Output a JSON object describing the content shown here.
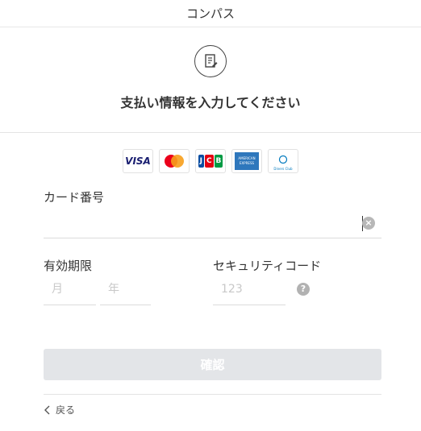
{
  "topbar": {
    "title": "コンパス"
  },
  "header": {
    "title": "支払い情報を入力してください"
  },
  "cards": [
    {
      "name": "VISA",
      "text": "VISA",
      "color": "#1a1f71"
    },
    {
      "name": "Mastercard",
      "text": "",
      "color": "#eb001b"
    },
    {
      "name": "JCB",
      "text": "JCB",
      "color": "#0b4ea2"
    },
    {
      "name": "American Express",
      "text": "AMERICAN EXPRESS",
      "color": "#2e77bc"
    },
    {
      "name": "Diners Club",
      "text": "Diners Club",
      "color": "#0079be"
    }
  ],
  "form": {
    "card_number_label": "カード番号",
    "card_number_value": "",
    "expiry_label": "有効期限",
    "month_placeholder": "月",
    "year_placeholder": "年",
    "security_label": "セキュリティコード",
    "security_placeholder": "123"
  },
  "actions": {
    "confirm_label": "確認",
    "back_label": "戻る"
  },
  "colors": {
    "confirm_bg": "#e3e5e8",
    "icon_gray": "#b2b2b2"
  }
}
